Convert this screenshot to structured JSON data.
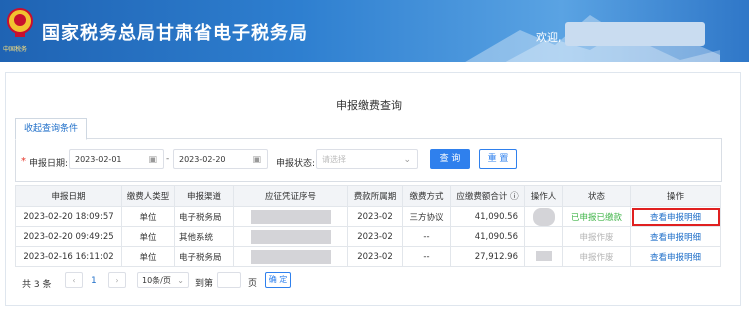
{
  "header": {
    "title": "国家税务总局甘肃省电子税务局",
    "emblem_caption": "中国税务",
    "welcome": "欢迎,"
  },
  "page": {
    "title": "申报缴费查询",
    "tab_label": "收起查询条件"
  },
  "filter": {
    "date_label": "申报日期:",
    "date_start": "2023-02-01",
    "date_end": "2023-02-20",
    "status_label": "申报状态:",
    "status_placeholder": "请选择",
    "query_label": "查 询",
    "reset_label": "重 置"
  },
  "table": {
    "columns": [
      "申报日期",
      "缴费人类型",
      "申报渠道",
      "应征凭证序号",
      "费款所属期",
      "缴费方式",
      "应缴费额合计 ⓘ",
      "操作人",
      "状态",
      "操作"
    ],
    "rows": [
      {
        "date": "2023-02-20 18:09:57",
        "payer_type": "单位",
        "channel": "电子税务局",
        "voucher": "",
        "period": "2023-02",
        "method": "三方协议",
        "amount": "41,090.56",
        "operator": "",
        "status": "已申报已缴款",
        "action": "查看申报明细"
      },
      {
        "date": "2023-02-20 09:49:25",
        "payer_type": "单位",
        "channel": "其他系统",
        "voucher": "",
        "period": "2023-02",
        "method": "--",
        "amount": "41,090.56",
        "operator": "",
        "status": "申报作废",
        "action": "查看申报明细"
      },
      {
        "date": "2023-02-16 16:11:02",
        "payer_type": "单位",
        "channel": "电子税务局",
        "voucher": "",
        "period": "2023-02",
        "method": "--",
        "amount": "27,912.96",
        "operator": "",
        "status": "申报作废",
        "action": "查看申报明细"
      }
    ]
  },
  "pager": {
    "total": "共 3 条",
    "current": "1",
    "page_size": "10条/页",
    "goto": "到第",
    "page_unit": "页",
    "confirm": "确 定"
  },
  "colors": {
    "primary": "#2f80ed",
    "success": "#41b54a",
    "muted": "#b5b5b5",
    "highlight": "#e02020"
  }
}
